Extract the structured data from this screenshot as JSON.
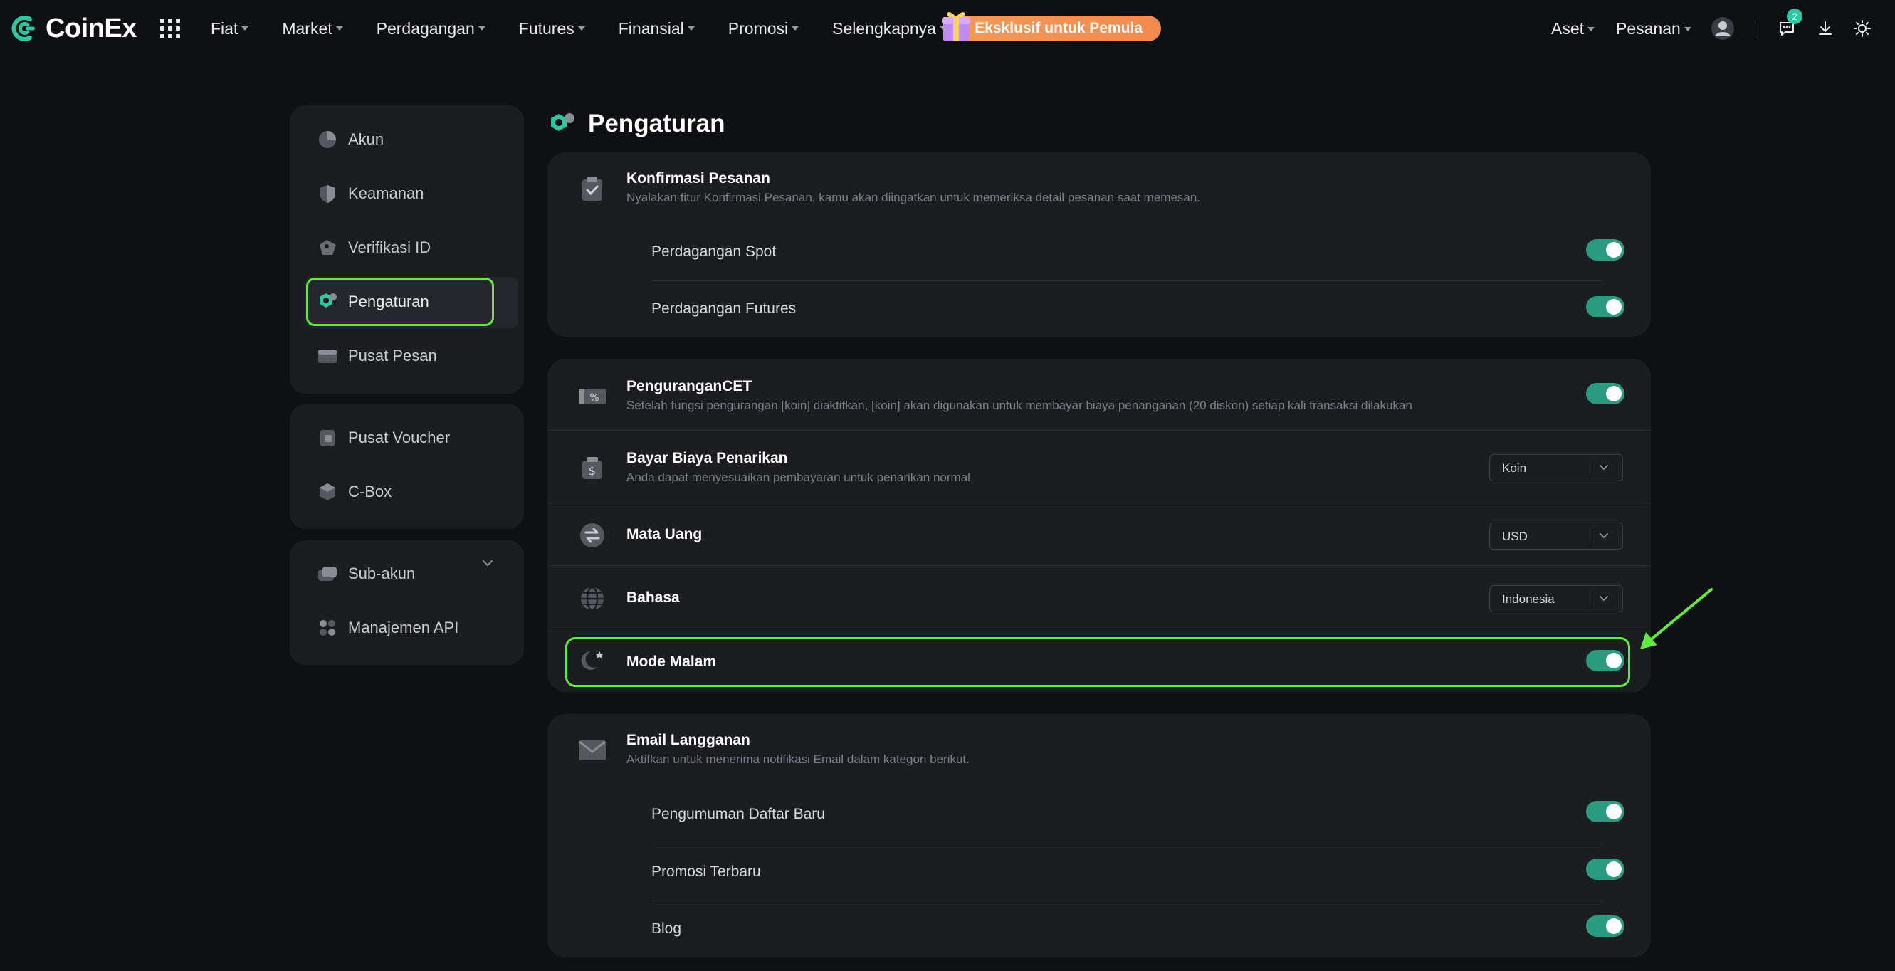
{
  "brand": {
    "name": "CoinEx",
    "accent": "#2cc7a0",
    "highlight": "#65e844"
  },
  "nav": {
    "items": [
      {
        "label": "Fiat"
      },
      {
        "label": "Market"
      },
      {
        "label": "Perdagangan"
      },
      {
        "label": "Futures"
      },
      {
        "label": "Finansial"
      },
      {
        "label": "Promosi"
      },
      {
        "label": "Selengkapnya"
      }
    ],
    "promo_label": "Eksklusif untuk Pemula",
    "assets_label": "Aset",
    "orders_label": "Pesanan",
    "notification_count": "2",
    "icons": [
      "grid-icon",
      "gift-icon",
      "avatar-icon",
      "message-icon",
      "download-icon",
      "sun-icon"
    ]
  },
  "sidebar": {
    "group1": [
      {
        "label": "Akun",
        "icon": "account-icon"
      },
      {
        "label": "Keamanan",
        "icon": "shield-icon"
      },
      {
        "label": "Verifikasi ID",
        "icon": "id-tag-icon"
      },
      {
        "label": "Pengaturan",
        "icon": "settings-icon",
        "active": true
      },
      {
        "label": "Pusat Pesan",
        "icon": "message-center-icon"
      }
    ],
    "group2": [
      {
        "label": "Pusat Voucher",
        "icon": "voucher-icon"
      },
      {
        "label": "C-Box",
        "icon": "box-icon"
      }
    ],
    "group3": [
      {
        "label": "Sub-akun",
        "icon": "sub-account-icon"
      },
      {
        "label": "Manajemen API",
        "icon": "api-icon"
      }
    ]
  },
  "page": {
    "title": "Pengaturan"
  },
  "order_confirm": {
    "title": "Konfirmasi Pesanan",
    "desc": "Nyalakan fitur Konfirmasi Pesanan, kamu akan diingatkan untuk memeriksa detail pesanan saat memesan.",
    "items": [
      {
        "label": "Perdagangan Spot",
        "on": true
      },
      {
        "label": "Perdagangan Futures",
        "on": true
      }
    ]
  },
  "general": {
    "cet": {
      "title": "PenguranganCET",
      "desc": "Setelah fungsi pengurangan [koin] diaktifkan, [koin] akan digunakan untuk membayar biaya penanganan (20 diskon) setiap kali transaksi dilakukan",
      "on": true
    },
    "withdraw_fee": {
      "title": "Bayar Biaya Penarikan",
      "desc": "Anda dapat menyesuaikan pembayaran untuk penarikan normal",
      "value": "Koin"
    },
    "currency": {
      "title": "Mata Uang",
      "value": "USD"
    },
    "language": {
      "title": "Bahasa",
      "value": "Indonesia"
    },
    "night_mode": {
      "title": "Mode Malam",
      "on": true
    }
  },
  "email": {
    "title": "Email Langganan",
    "desc": "Aktifkan untuk menerima notifikasi Email dalam kategori berikut.",
    "items": [
      {
        "label": "Pengumuman Daftar Baru",
        "on": true
      },
      {
        "label": "Promosi Terbaru",
        "on": true
      },
      {
        "label": "Blog",
        "on": true
      }
    ]
  }
}
